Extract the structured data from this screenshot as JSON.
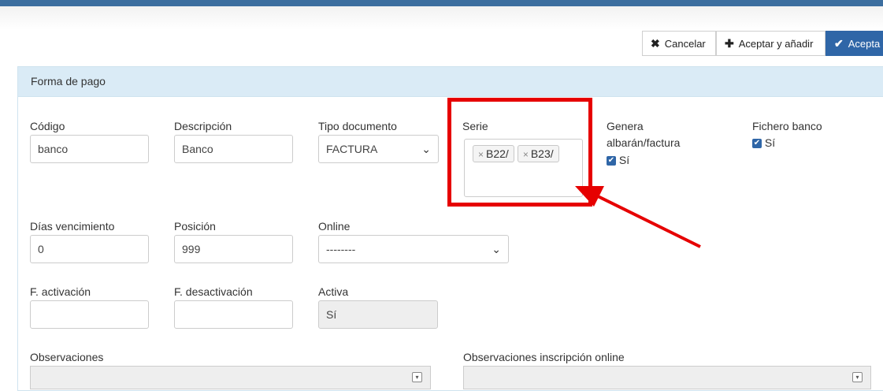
{
  "toolbar": {
    "cancel": {
      "icon": "close-icon",
      "label": "Cancelar"
    },
    "add": {
      "icon": "plus-icon",
      "label": "Aceptar y añadir"
    },
    "accept": {
      "icon": "check-icon",
      "label": "Acepta"
    }
  },
  "panel": {
    "title": "Forma de pago"
  },
  "fields": {
    "codigo": {
      "label": "Código",
      "value": "banco"
    },
    "descripcion": {
      "label": "Descripción",
      "value": "Banco"
    },
    "tipo_documento": {
      "label": "Tipo documento",
      "value": "FACTURA"
    },
    "serie": {
      "label": "Serie",
      "tags": [
        "B22/",
        "B23/"
      ]
    },
    "genera": {
      "label_line1": "Genera",
      "label_line2": "albarán/factura",
      "checked": true,
      "text": "Sí"
    },
    "fichero_banco": {
      "label": "Fichero banco",
      "checked": true,
      "text": "Sí"
    },
    "dias_vencimiento": {
      "label": "Días vencimiento",
      "value": "0"
    },
    "posicion": {
      "label": "Posición",
      "value": "999"
    },
    "online": {
      "label": "Online",
      "value": "--------"
    },
    "f_activacion": {
      "label": "F. activación",
      "value": ""
    },
    "f_desactivacion": {
      "label": "F. desactivación",
      "value": ""
    },
    "activa": {
      "label": "Activa",
      "value": "Sí"
    },
    "observaciones": {
      "label": "Observaciones"
    },
    "observaciones_online": {
      "label": "Observaciones inscripción online"
    }
  },
  "colors": {
    "header_bar": "#3c6e9f",
    "accent": "#2f66a7",
    "highlight": "#e60000",
    "panel_header": "#daebf6"
  }
}
